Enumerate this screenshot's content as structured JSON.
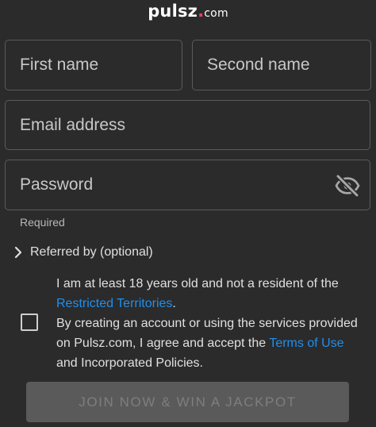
{
  "brand": {
    "name": "pulsz",
    "dot": ".",
    "tld": "com"
  },
  "form": {
    "first_name_placeholder": "First name",
    "second_name_placeholder": "Second name",
    "email_placeholder": "Email address",
    "password_placeholder": "Password",
    "password_toggle_icon": "eye-off-icon",
    "required_text": "Required",
    "referred_label": "Referred by (optional)",
    "referred_icon": "chevron-right-icon"
  },
  "consent": {
    "line1_before": "I am at least 18 years old and not a resident of the ",
    "restricted_link": "Restricted Territories",
    "line1_after": ".",
    "line2_before": "By creating an account or using the services provided on Pulsz.com, I agree and accept the ",
    "terms_link": "Terms of Use",
    "line2_after": " and Incorporated Policies.",
    "checked": false
  },
  "submit": {
    "label": "JOIN NOW & WIN A JACKPOT",
    "disabled": true
  },
  "colors": {
    "background": "#2b2b2b",
    "field_border": "#5b5b5b",
    "link": "#1f8ff0",
    "button_bg": "#5a5a5a",
    "button_text": "#7e7e7e",
    "brand_dot": "#ff3b5c"
  }
}
